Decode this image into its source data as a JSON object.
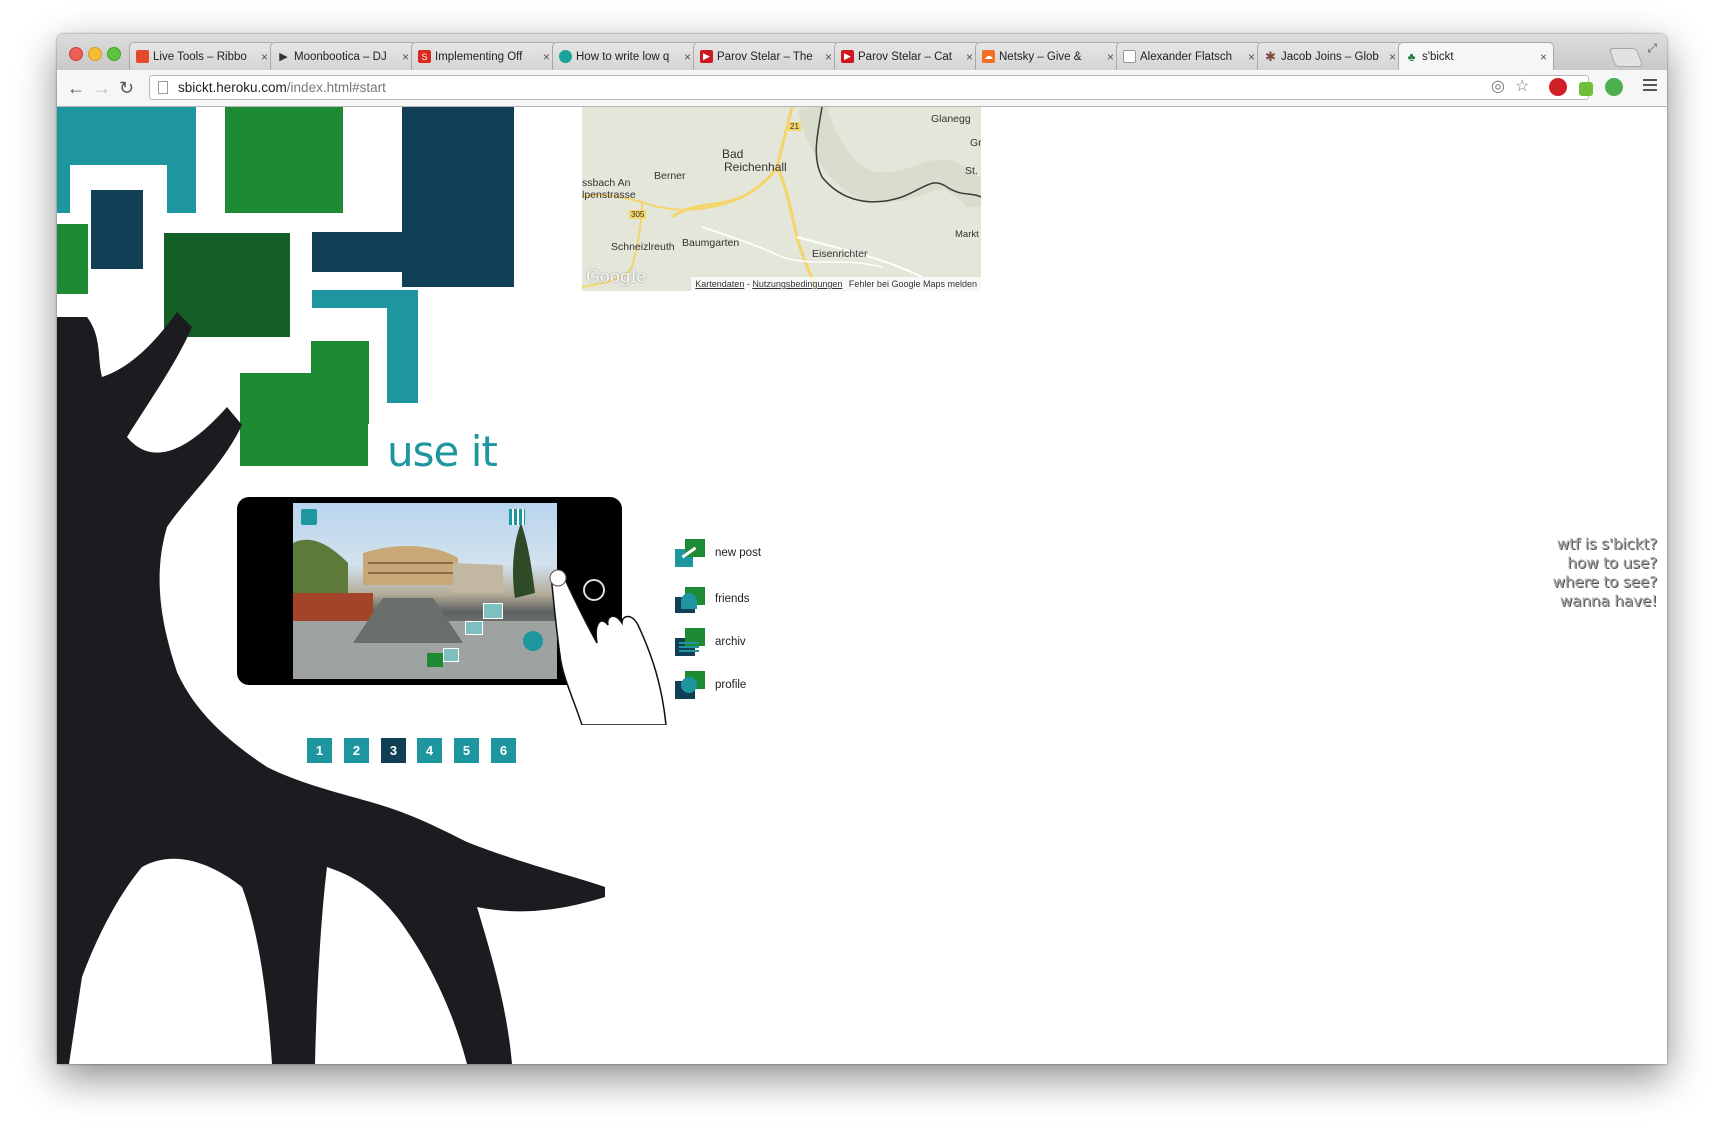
{
  "browser": {
    "tabs": [
      {
        "label": "Live Tools – Ribbo",
        "fav_color": "#e44a2a"
      },
      {
        "label": "Moonbootica – DJ",
        "fav_color": "#333333"
      },
      {
        "label": "Implementing Off",
        "fav_color": "#d9291c"
      },
      {
        "label": "How to write low q",
        "fav_color": "#1aa39a"
      },
      {
        "label": "Parov Stelar – The",
        "fav_color": "#cc181e"
      },
      {
        "label": "Parov Stelar – Cat",
        "fav_color": "#cc181e"
      },
      {
        "label": "Netsky – Give &",
        "fav_color": "#f26f23"
      },
      {
        "label": "Alexander Flatsch",
        "fav_color": "#ffffff"
      },
      {
        "label": "Jacob Joins – Glob",
        "fav_color": "#7a4a3a"
      },
      {
        "label": "s'bickt",
        "fav_color": "#2a7a4a"
      }
    ],
    "url_host": "sbickt.heroku.com",
    "url_path": "/index.html#start"
  },
  "map": {
    "places": [
      "Glanegg",
      "Bad",
      "Reichenhall",
      "Berner",
      "ssbach An",
      "lpenstrasse",
      "Schneizlreuth",
      "Baumgarten",
      "Eisenrichter",
      "Markt",
      "St.",
      "Gr"
    ],
    "road_21": "21",
    "road_305": "305",
    "logo": "Google",
    "footer_link1": "Kartendaten",
    "footer_sep": " - ",
    "footer_link2": "Nutzungsbedingungen",
    "footer_report": "Fehler bei Google Maps melden"
  },
  "section_title": "use it",
  "app_menu": [
    {
      "label": "new post"
    },
    {
      "label": "friends"
    },
    {
      "label": "archiv"
    },
    {
      "label": "profile"
    }
  ],
  "pagination": [
    "1",
    "2",
    "3",
    "4",
    "5",
    "6"
  ],
  "pagination_active": "3",
  "side_links": [
    "wtf is s'bickt?",
    "how to use?",
    "where to see?",
    "wanna have!"
  ],
  "colors": {
    "teal": "#1e96a0",
    "navy": "#113f55",
    "green": "#1d8a34",
    "dark_green": "#145e28",
    "trunk": "#1c1b1f"
  }
}
